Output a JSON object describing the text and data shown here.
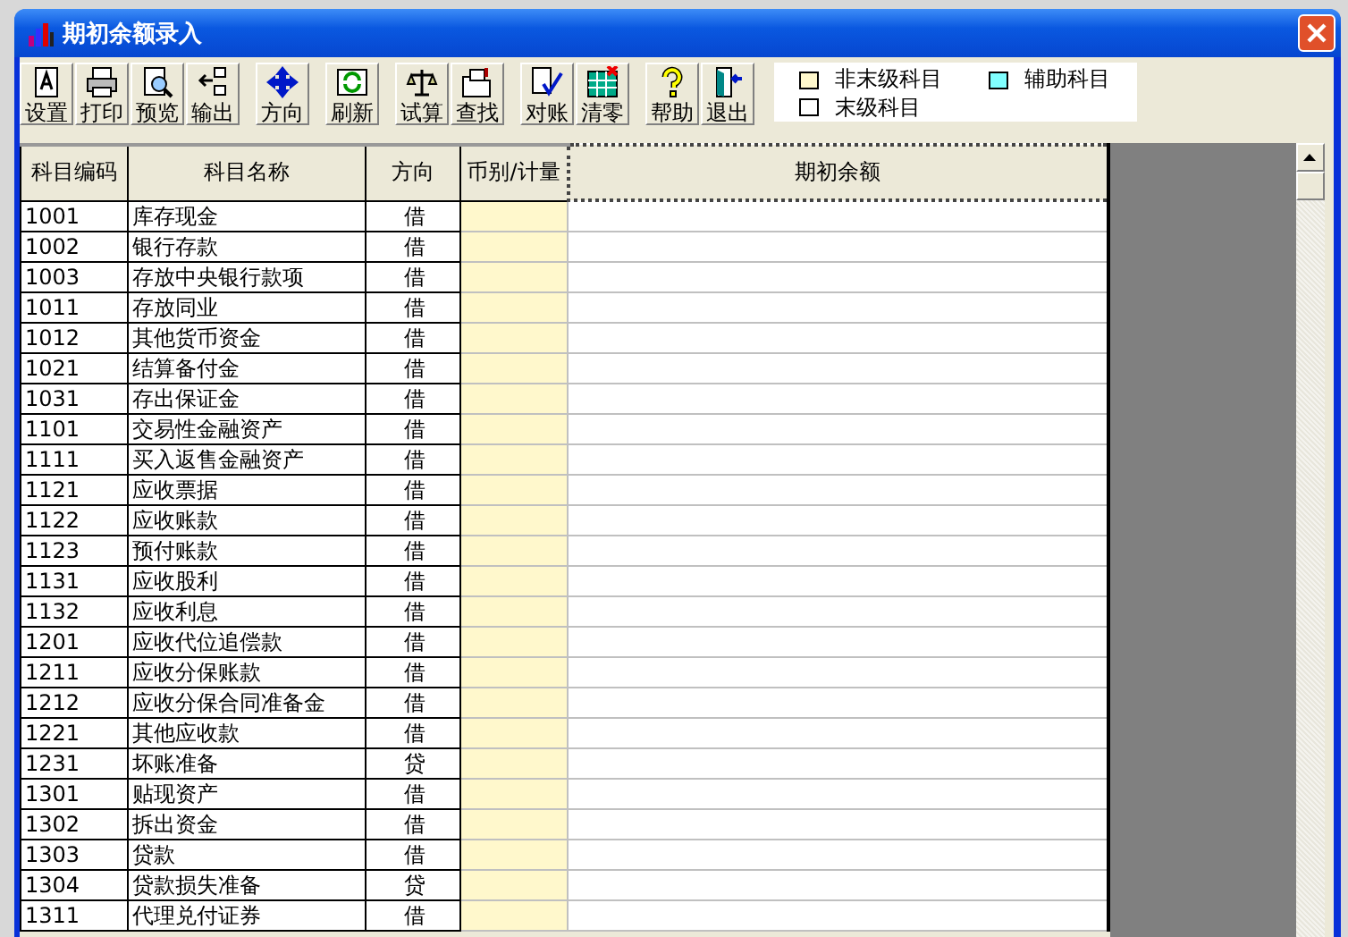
{
  "window": {
    "title": "期初余额录入"
  },
  "toolbar": {
    "groups": [
      [
        {
          "label": "设置"
        },
        {
          "label": "打印"
        },
        {
          "label": "预览"
        },
        {
          "label": "输出"
        }
      ],
      [
        {
          "label": "方向"
        }
      ],
      [
        {
          "label": "刷新"
        }
      ],
      [
        {
          "label": "试算"
        },
        {
          "label": "查找"
        }
      ],
      [
        {
          "label": "对账"
        },
        {
          "label": "清零"
        }
      ],
      [
        {
          "label": "帮助"
        },
        {
          "label": "退出"
        }
      ]
    ]
  },
  "legend": [
    {
      "label": "非末级科目",
      "color": "#fff8cc"
    },
    {
      "label": "辅助科目",
      "color": "#80ffff"
    },
    {
      "label": "末级科目",
      "color": "#ffffff"
    }
  ],
  "table": {
    "columns": [
      "科目编码",
      "科目名称",
      "方向",
      "币别/计量",
      "期初余额"
    ],
    "rows": [
      {
        "code": "1001",
        "name": "库存现金",
        "direction": "借"
      },
      {
        "code": "1002",
        "name": "银行存款",
        "direction": "借"
      },
      {
        "code": "1003",
        "name": "存放中央银行款项",
        "direction": "借"
      },
      {
        "code": "1011",
        "name": "存放同业",
        "direction": "借"
      },
      {
        "code": "1012",
        "name": "其他货币资金",
        "direction": "借"
      },
      {
        "code": "1021",
        "name": "结算备付金",
        "direction": "借"
      },
      {
        "code": "1031",
        "name": "存出保证金",
        "direction": "借"
      },
      {
        "code": "1101",
        "name": "交易性金融资产",
        "direction": "借"
      },
      {
        "code": "1111",
        "name": "买入返售金融资产",
        "direction": "借"
      },
      {
        "code": "1121",
        "name": "应收票据",
        "direction": "借"
      },
      {
        "code": "1122",
        "name": "应收账款",
        "direction": "借"
      },
      {
        "code": "1123",
        "name": "预付账款",
        "direction": "借"
      },
      {
        "code": "1131",
        "name": "应收股利",
        "direction": "借"
      },
      {
        "code": "1132",
        "name": "应收利息",
        "direction": "借"
      },
      {
        "code": "1201",
        "name": "应收代位追偿款",
        "direction": "借"
      },
      {
        "code": "1211",
        "name": "应收分保账款",
        "direction": "借"
      },
      {
        "code": "1212",
        "name": "应收分保合同准备金",
        "direction": "借"
      },
      {
        "code": "1221",
        "name": "其他应收款",
        "direction": "借"
      },
      {
        "code": "1231",
        "name": "坏账准备",
        "direction": "贷"
      },
      {
        "code": "1301",
        "name": "贴现资产",
        "direction": "借"
      },
      {
        "code": "1302",
        "name": "拆出资金",
        "direction": "借"
      },
      {
        "code": "1303",
        "name": "贷款",
        "direction": "借"
      },
      {
        "code": "1304",
        "name": "贷款损失准备",
        "direction": "贷"
      },
      {
        "code": "1311",
        "name": "代理兑付证券",
        "direction": "借"
      }
    ]
  }
}
